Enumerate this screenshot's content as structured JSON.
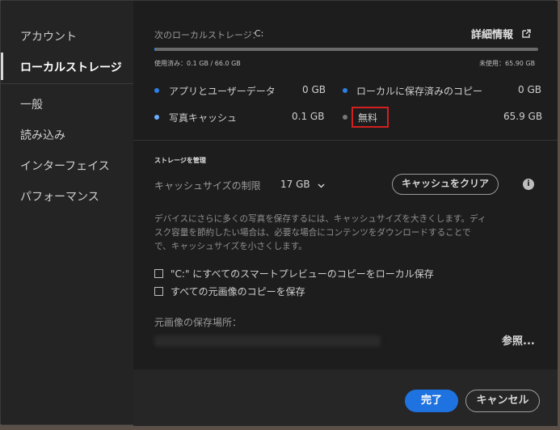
{
  "sidebar": {
    "items": [
      {
        "label": "アカウント"
      },
      {
        "label": "ローカルストレージ"
      },
      {
        "label": "一般"
      },
      {
        "label": "読み込み"
      },
      {
        "label": "インターフェイス"
      },
      {
        "label": "パフォーマンス"
      }
    ],
    "active_index": 1
  },
  "storage": {
    "drive_label": "次のローカルストレージ：",
    "drive": "C:",
    "details_link": "詳細情報",
    "used": "使用済み：0.1 GB / 66.0 GB",
    "unused": "未使用：65.90 GB",
    "used_fraction": 0.0015
  },
  "legend": {
    "app_user_data": {
      "label": "アプリとユーザーデータ",
      "value": "0 GB",
      "color": "#2d7fe6"
    },
    "local_copies": {
      "label": "ローカルに保存済みのコピー",
      "value": "0 GB",
      "color": "#2d7fe6"
    },
    "photo_cache": {
      "label": "写真キャッシュ",
      "value": "0.1 GB",
      "color": "#6aaeff"
    },
    "free": {
      "label": "無料",
      "value": "65.9 GB",
      "color": "#777777"
    }
  },
  "manage": {
    "heading": "ストレージを管理",
    "cache_limit_label": "キャッシュサイズの制限",
    "cache_limit_value": "17 GB",
    "clear_cache_button": "キャッシュをクリア",
    "description": "デバイスにさらに多くの写真を保存するには、キャッシュサイズを大きくします。ディスク容量を節約したい場合は、必要な場合にコンテンツをダウンロードすることで、キャッシュサイズを小さくします。",
    "description_lines": [
      "デバイスにさらに多くの写真を保存するには、キャッシュサイズを大きくします。ディ",
      "スク容量を節約したい場合は、必要な場合にコンテンツをダウンロードすることで",
      "で、キャッシュサイズを小さくします。"
    ],
    "checkbox_smart_previews": "\"C:\" にすべてのスマートプレビューのコピーをローカル保存",
    "checkbox_originals": "すべての元画像のコピーを保存",
    "originals_location_label": "元画像の保存場所：",
    "browse_link": "参照..."
  },
  "footer": {
    "done_button": "完了",
    "cancel_button": "キャンセル"
  }
}
